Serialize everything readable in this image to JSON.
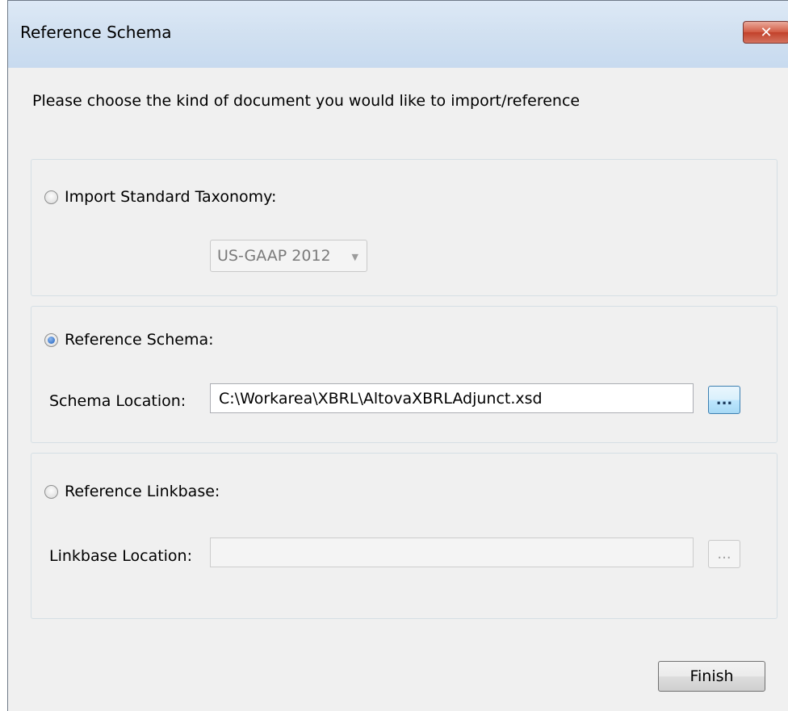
{
  "window": {
    "title": "Reference Schema",
    "close_label": "✕"
  },
  "instruction": "Please choose the kind of document you would like to import/reference",
  "options": {
    "import_taxonomy": {
      "label": "Import Standard Taxonomy:",
      "selected": false,
      "taxonomy_value": "US-GAAP 2012"
    },
    "reference_schema": {
      "label": "Reference Schema:",
      "selected": true,
      "location_label": "Schema Location:",
      "location_value": "C:\\Workarea\\XBRL\\AltovaXBRLAdjunct.xsd",
      "browse_label": "..."
    },
    "reference_linkbase": {
      "label": "Reference Linkbase:",
      "selected": false,
      "location_label": "Linkbase Location:",
      "location_value": "",
      "browse_label": "..."
    }
  },
  "buttons": {
    "finish_label": "Finish"
  }
}
